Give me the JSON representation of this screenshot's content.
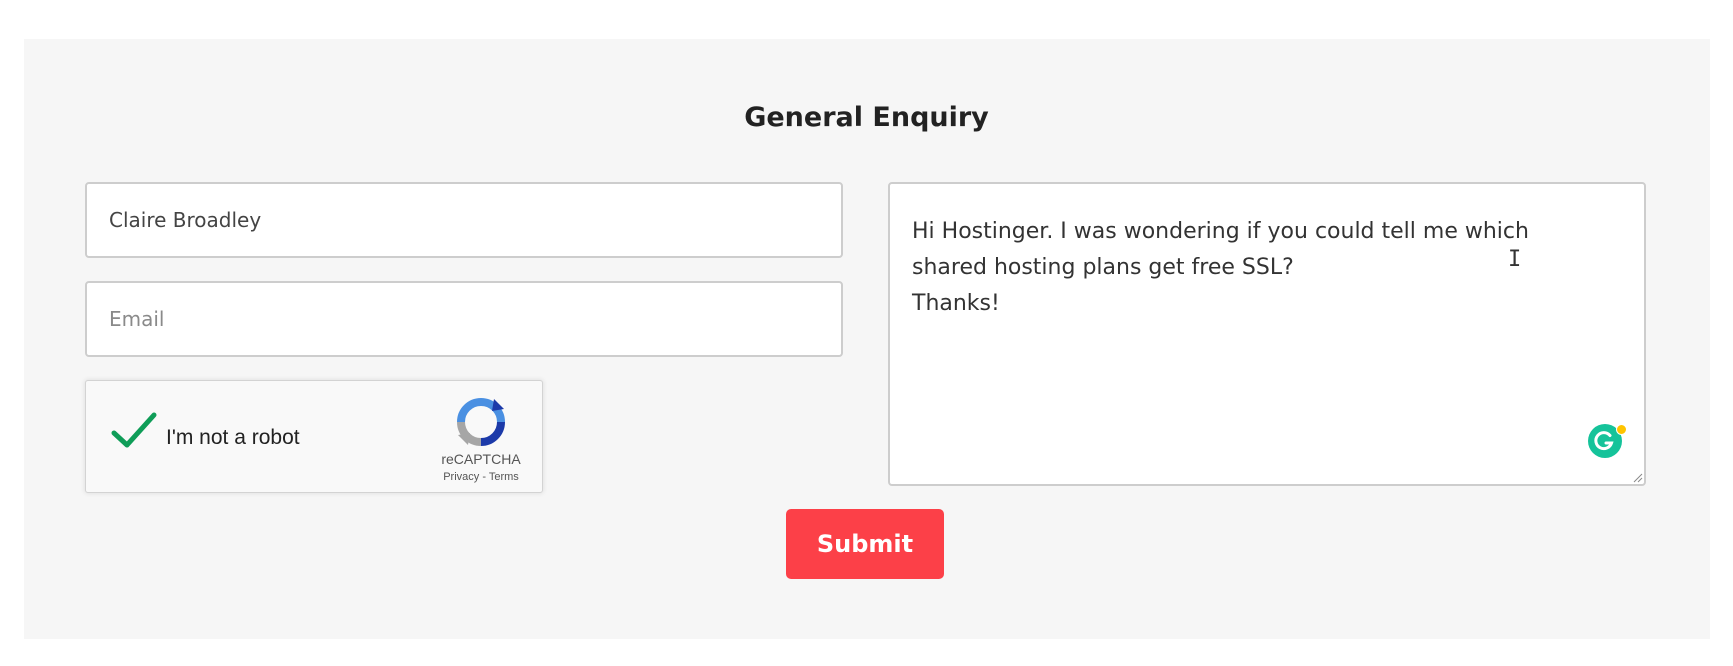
{
  "form": {
    "title": "General Enquiry",
    "name_value": "Claire Broadley",
    "email_placeholder": "Email",
    "message_value": "Hi Hostinger. I was wondering if you could tell me which shared hosting plans get free SSL?\nThanks!",
    "submit_label": "Submit"
  },
  "captcha": {
    "label": "I'm not a robot",
    "checked": true,
    "brand": "reCAPTCHA",
    "privacy_label": "Privacy",
    "separator": " - ",
    "terms_label": "Terms"
  },
  "icons": {
    "checkmark": "checkmark-icon",
    "recaptcha": "recaptcha-logo-icon",
    "grammarly": "grammarly-icon",
    "text_cursor": "text-cursor-icon"
  },
  "colors": {
    "accent": "#fc4048",
    "panel_background": "#f6f6f6",
    "checkmark": "#0f9d58",
    "grammarly": "#15c39a"
  }
}
